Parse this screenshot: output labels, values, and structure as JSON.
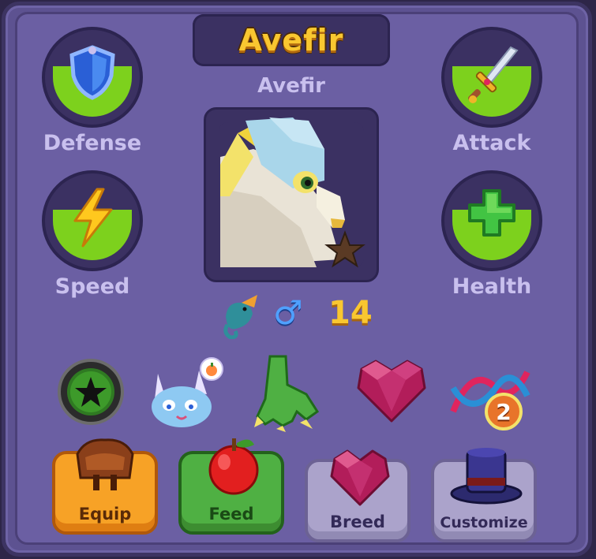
{
  "header": {
    "title": "Avefir",
    "subtitle": "Avefir"
  },
  "stats": [
    {
      "label": "Defense",
      "icon": "shield-icon",
      "fill_fraction": 0.5
    },
    {
      "label": "Attack",
      "icon": "sword-icon",
      "fill_fraction": 0.5
    },
    {
      "label": "Speed",
      "icon": "lightning-icon",
      "fill_fraction": 0.5
    },
    {
      "label": "Health",
      "icon": "plus-icon",
      "fill_fraction": 0.5
    }
  ],
  "creature": {
    "portrait": "bird-creature-portrait",
    "badge": "brown-star-icon",
    "species_icon": "dragon-icon",
    "gender_symbol": "♂",
    "level": "14"
  },
  "traits": [
    {
      "name": "black-star-green-orb-icon"
    },
    {
      "name": "blue-creature-hungry-icon"
    },
    {
      "name": "green-claw-icon"
    },
    {
      "name": "crystal-heart-icon"
    },
    {
      "name": "dna-icon",
      "badge": "2"
    }
  ],
  "actions": [
    {
      "label": "Equip",
      "icon": "saddle-icon"
    },
    {
      "label": "Feed",
      "icon": "apple-icon"
    },
    {
      "label": "Breed",
      "icon": "crystal-heart-icon"
    },
    {
      "label": "Customize",
      "icon": "top-hat-icon"
    }
  ],
  "colors": {
    "panel": "#6b5fa3",
    "title": "#f9c730",
    "stat_fill": "#7dd11d",
    "equip": "#f7a226",
    "feed": "#4fb043",
    "disabled": "#aba3cb"
  }
}
